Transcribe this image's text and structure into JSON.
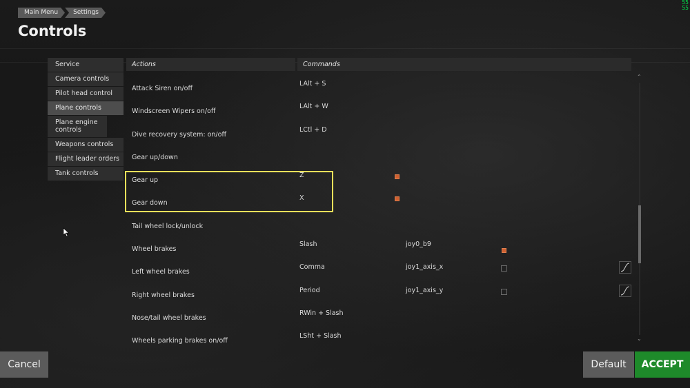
{
  "breadcrumb": [
    "Main Menu",
    "Settings"
  ],
  "page_title": "Controls",
  "fps": [
    "55",
    "55"
  ],
  "sidebar": {
    "items": [
      {
        "label": "Service"
      },
      {
        "label": "Camera controls"
      },
      {
        "label": "Pilot head control"
      },
      {
        "label": "Plane controls",
        "active": true
      },
      {
        "label": "Plane engine controls"
      },
      {
        "label": "Weapons controls"
      },
      {
        "label": "Flight leader orders"
      },
      {
        "label": "Tank controls"
      }
    ]
  },
  "table": {
    "headers": {
      "actions": "Actions",
      "commands": "Commands"
    },
    "rows": [
      {
        "action": "Attack Siren on/off",
        "command": "LAlt + S",
        "device": ""
      },
      {
        "action": "Windscreen Wipers on/off",
        "command": "LAlt + W",
        "device": ""
      },
      {
        "action": "Dive recovery system: on/off",
        "command": "LCtl + D",
        "device": ""
      },
      {
        "action": "Gear up/down",
        "command": "",
        "device": ""
      },
      {
        "action": "Gear up",
        "command": "Z",
        "device": "",
        "warning": true
      },
      {
        "action": "Gear down",
        "command": "X",
        "device": "",
        "warning": true
      },
      {
        "action": "Tail wheel lock/unlock",
        "command": "",
        "device": ""
      },
      {
        "action": "Wheel brakes",
        "command": "Slash",
        "device": "joy0_b9",
        "device_warning": true
      },
      {
        "action": "Left wheel brakes",
        "command": "Comma",
        "device": "joy1_axis_x",
        "curve": true
      },
      {
        "action": "Right wheel brakes",
        "command": "Period",
        "device": "joy1_axis_y",
        "curve": true
      },
      {
        "action": "Nose/tail wheel brakes",
        "command": "RWin + Slash",
        "device": ""
      },
      {
        "action": "Wheels parking brakes on/off",
        "command": "LSht + Slash",
        "device": ""
      }
    ]
  },
  "buttons": {
    "cancel": "Cancel",
    "default": "Default",
    "accept": "ACCEPT"
  },
  "colors": {
    "accept": "#1e8a2a",
    "highlight": "#e8e05a",
    "warning": "#d06030"
  }
}
